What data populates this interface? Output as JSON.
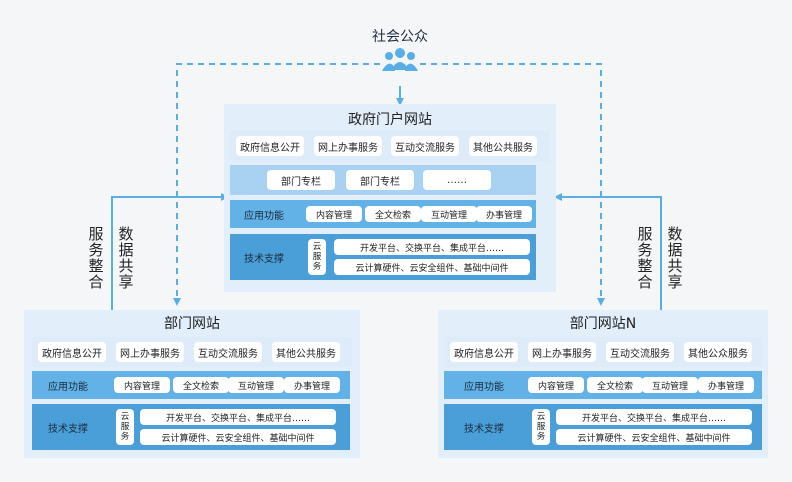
{
  "public": {
    "label": "社会公众",
    "icon": "people-icon"
  },
  "portal": {
    "title": "政府门户网站",
    "services": [
      "政府信息公开",
      "网上办事服务",
      "互动交流服务",
      "其他公共服务"
    ],
    "columns": [
      "部门专栏",
      "部门专栏",
      "……"
    ],
    "app_label": "应用功能",
    "apps": [
      "内容管理",
      "全文检索",
      "互动管理",
      "办事管理"
    ],
    "tech_label": "技术支撑",
    "cloud": "云服务",
    "tech_items": [
      "开发平台、交换平台、集成平台……",
      "云计算硬件、云安全组件、基础中间件"
    ]
  },
  "dept_left": {
    "title": "部门网站",
    "services": [
      "政府信息公开",
      "网上办事服务",
      "互动交流服务",
      "其他公共服务"
    ],
    "app_label": "应用功能",
    "apps": [
      "内容管理",
      "全文检索",
      "互动管理",
      "办事管理"
    ],
    "tech_label": "技术支撑",
    "cloud": "云服务",
    "tech_items": [
      "开发平台、交换平台、集成平台……",
      "云计算硬件、云安全组件、基础中间件"
    ]
  },
  "dept_right": {
    "title": "部门网站N",
    "services": [
      "政府信息公开",
      "网上办事服务",
      "互动交流服务",
      "其他公众服务"
    ],
    "app_label": "应用功能",
    "apps": [
      "内容管理",
      "全文检索",
      "互动管理",
      "办事管理"
    ],
    "tech_label": "技术支撑",
    "cloud": "云服务",
    "tech_items": [
      "开发平台、交换平台、集成平台……",
      "云计算硬件、云安全组件、基础中间件"
    ]
  },
  "side_labels": {
    "left_service": "服务整合",
    "left_data": "数据共享",
    "right_service": "服务整合",
    "right_data": "数据共享"
  },
  "colors": {
    "arrow": "#5aaee6",
    "panel": "#e3eefb",
    "row_light": "#deebf8",
    "row_mid": "#a9d1f2",
    "row_app": "#62b2e8",
    "row_tech": "#4a9fd8"
  }
}
